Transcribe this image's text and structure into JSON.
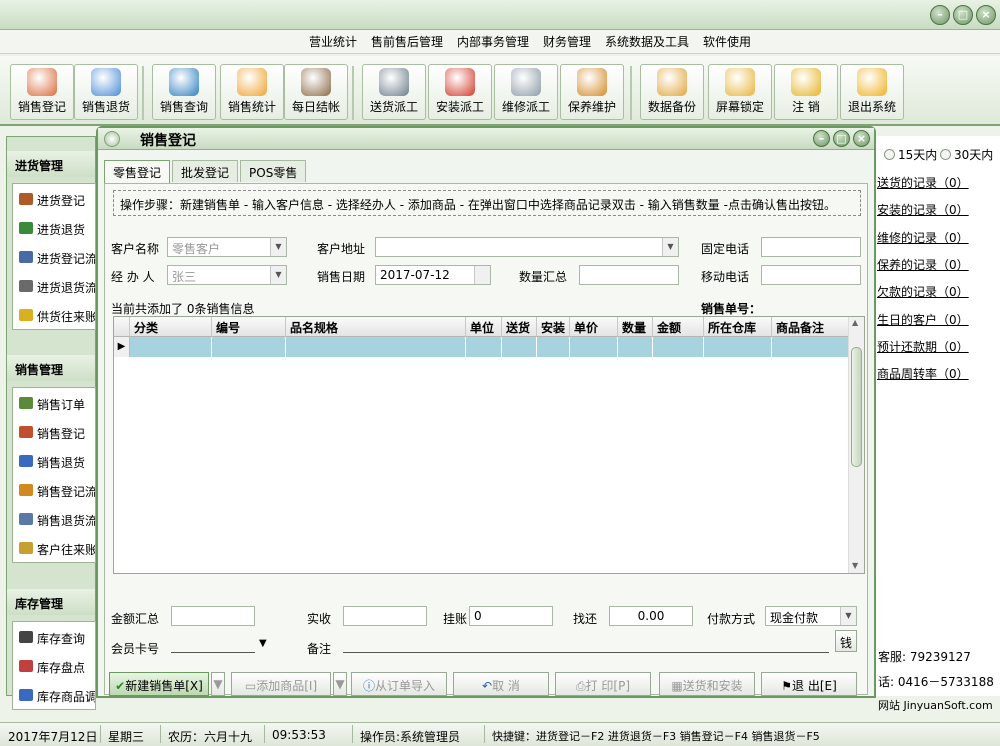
{
  "menu": [
    "营业统计",
    "售前售后管理",
    "内部事务管理",
    "财务管理",
    "系统数据及工具",
    "软件使用"
  ],
  "toolbar": [
    {
      "label": "销售登记",
      "icon": "sales-register-icon",
      "color": "#d96b3a"
    },
    {
      "label": "销售退货",
      "icon": "sales-return-icon",
      "color": "#4a8bd6"
    },
    {
      "label": "销售查询",
      "icon": "magnifier-icon",
      "color": "#2f7fbf"
    },
    {
      "label": "销售统计",
      "icon": "stats-icon",
      "color": "#f0a230"
    },
    {
      "label": "每日结帐",
      "icon": "person-icon",
      "color": "#8b6a46"
    },
    {
      "label": "送货派工",
      "icon": "paper-plane-icon",
      "color": "#6d7d8c"
    },
    {
      "label": "安装派工",
      "icon": "house-icon",
      "color": "#d23a2a"
    },
    {
      "label": "维修派工",
      "icon": "wrench-icon",
      "color": "#8c9aa6"
    },
    {
      "label": "保养维护",
      "icon": "gauge-icon",
      "color": "#d48b2a"
    },
    {
      "label": "数据备份",
      "icon": "folder-icon",
      "color": "#e0a63c"
    },
    {
      "label": "屏幕锁定",
      "icon": "lock-icon",
      "color": "#e8b43a"
    },
    {
      "label": "注 销",
      "icon": "key-icon",
      "color": "#e6b323"
    },
    {
      "label": "退出系统",
      "icon": "exit-icon",
      "color": "#f0b020"
    }
  ],
  "left": {
    "sections": [
      {
        "title": "进货管理",
        "items": [
          {
            "label": "进货登记",
            "color": "#b05a2a"
          },
          {
            "label": "进货退货",
            "color": "#3a8a3a"
          },
          {
            "label": "进货登记流",
            "color": "#4a6aa6"
          },
          {
            "label": "进货退货流",
            "color": "#6a6a6a"
          },
          {
            "label": "供货往来账",
            "color": "#d8b020"
          }
        ]
      },
      {
        "title": "销售管理",
        "items": [
          {
            "label": "销售订单",
            "color": "#5a8a3a"
          },
          {
            "label": "销售登记",
            "color": "#c05030"
          },
          {
            "label": "销售退货",
            "color": "#3a6ac0"
          },
          {
            "label": "销售登记流",
            "color": "#d08a20"
          },
          {
            "label": "销售退货流",
            "color": "#5a7aa6"
          },
          {
            "label": "客户往来账",
            "color": "#c8a030"
          }
        ]
      },
      {
        "title": "库存管理",
        "items": [
          {
            "label": "库存查询",
            "color": "#444444"
          },
          {
            "label": "库存盘点",
            "color": "#c04040"
          },
          {
            "label": "库存商品调",
            "color": "#3a6ac0"
          }
        ]
      }
    ]
  },
  "right": {
    "radio1": "15天内",
    "radio2": "30天内",
    "links": [
      "送货的记录（0）",
      "安装的记录（0）",
      "维修的记录（0）",
      "保养的记录（0）",
      "欠款的记录（0）",
      "生日的客户（0）",
      "预计还款期（0）",
      "商品周转率（0）"
    ],
    "service": "客服: 79239127",
    "phone": "话: 0416－5733188",
    "site": "网站 JinyuanSoft.com"
  },
  "dialog": {
    "title": "销售登记",
    "tabs": [
      "零售登记",
      "批发登记",
      "POS零售"
    ],
    "steps": "操作步骤：新建销售单 - 输入客户信息 - 选择经办人 - 添加商品 - 在弹出窗口中选择商品记录双击 - 输入销售数量 -点击确认售出按钮。",
    "labels": {
      "customer": "客户名称",
      "address": "客户地址",
      "fixed_phone": "固定电话",
      "handler": "经 办 人",
      "date": "销售日期",
      "qty_total": "数量汇总",
      "mobile": "移动电话",
      "added": "当前共添加了 0条销售信息",
      "order_no": "销售单号：",
      "amount_total": "金额汇总",
      "paid": "实收",
      "credit": "挂账",
      "change": "找还",
      "pay_method": "付款方式",
      "member": "会员卡号",
      "remark": "备注"
    },
    "values": {
      "customer": "零售客户",
      "handler": "张三",
      "date": "2017-07-12",
      "credit": "0",
      "change": "0.00",
      "pay_method": "现金付款",
      "cash_btn": "钱"
    },
    "columns": [
      "分类",
      "编号",
      "品名规格",
      "单位",
      "送货",
      "安装",
      "单价",
      "数量",
      "金额",
      "所在仓库",
      "商品备注"
    ],
    "buttons": [
      "新建销售单[X]",
      "添加商品[I]",
      "从订单导入",
      "取 消",
      "打 印[P]",
      "送货和安装",
      "退 出[E]"
    ]
  },
  "status": {
    "date": "2017年7月12日",
    "weekday": "星期三",
    "lunar": "农历：六月十九",
    "time": "09:53:53",
    "operator": "操作员:系统管理员",
    "shortcuts": "快捷键：进货登记－F2 进货退货－F3 销售登记－F4 销售退货－F5"
  }
}
